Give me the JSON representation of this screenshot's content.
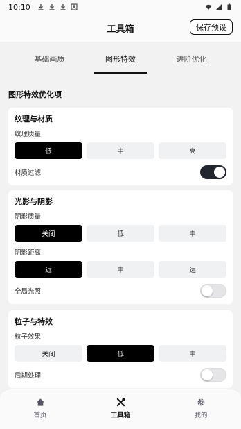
{
  "status_bar": {
    "time": "10:10",
    "notification_icons": [
      "download-icon",
      "download-icon",
      "download-icon",
      "a-icon"
    ],
    "right_icons": [
      "wifi-icon",
      "signal-icon",
      "battery-icon"
    ]
  },
  "header": {
    "title": "工具箱",
    "save_label": "保存预设"
  },
  "tabs": [
    {
      "label": "基础画质",
      "active": false
    },
    {
      "label": "图形特效",
      "active": true
    },
    {
      "label": "进阶优化",
      "active": false
    }
  ],
  "section_title": "图形特效优化项",
  "cards": {
    "texture": {
      "title": "纹理与材质",
      "quality_label": "纹理质量",
      "options": [
        "低",
        "中",
        "高"
      ],
      "selected": 0,
      "filter_label": "材质过滤",
      "filter_on": true
    },
    "lighting": {
      "title": "光影与阴影",
      "shadow_quality_label": "阴影质量",
      "shadow_quality_options": [
        "关闭",
        "低",
        "中"
      ],
      "shadow_quality_selected": 0,
      "shadow_distance_label": "阴影距离",
      "shadow_distance_options": [
        "近",
        "中",
        "远"
      ],
      "shadow_distance_selected": 0,
      "gi_label": "全局光照",
      "gi_on": false
    },
    "particles": {
      "title": "粒子与特效",
      "effect_label": "粒子效果",
      "options": [
        "关闭",
        "低",
        "中"
      ],
      "selected": 1,
      "post_label": "后期处理",
      "post_on": false
    }
  },
  "bottom_nav": [
    {
      "label": "首页",
      "icon": "home-icon",
      "active": false
    },
    {
      "label": "工具箱",
      "icon": "tools-icon",
      "active": true
    },
    {
      "label": "我的",
      "icon": "gear-icon",
      "active": false
    }
  ]
}
